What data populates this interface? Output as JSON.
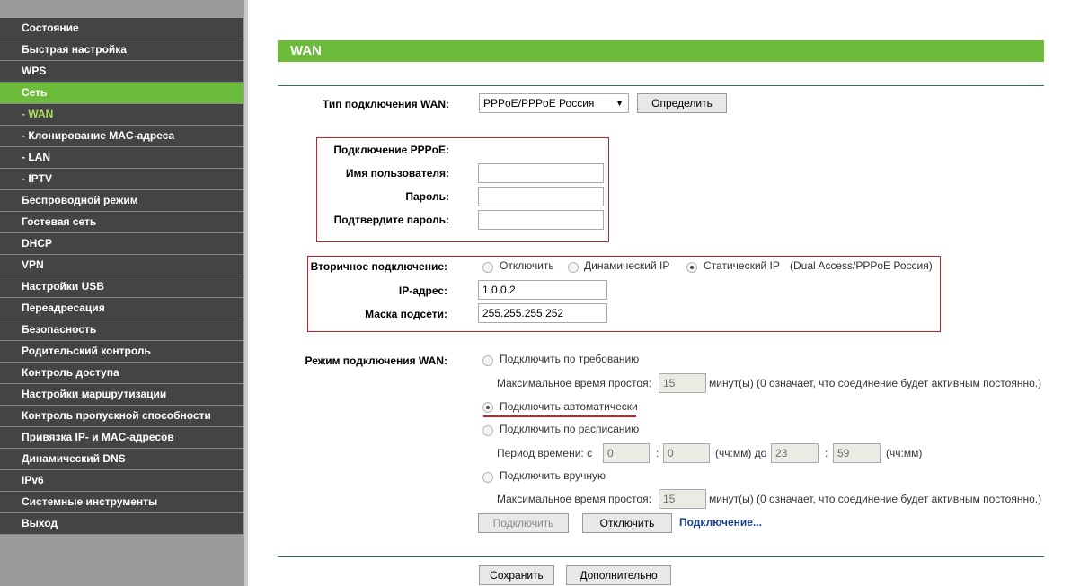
{
  "sidebar": {
    "items": [
      {
        "label": "Состояние",
        "state": ""
      },
      {
        "label": "Быстрая настройка",
        "state": ""
      },
      {
        "label": "WPS",
        "state": ""
      },
      {
        "label": "Сеть",
        "state": "active"
      },
      {
        "label": "- WAN",
        "state": "sub-active"
      },
      {
        "label": "- Клонирование MAC-адреса",
        "state": ""
      },
      {
        "label": "- LAN",
        "state": ""
      },
      {
        "label": "- IPTV",
        "state": ""
      },
      {
        "label": "Беспроводной режим",
        "state": ""
      },
      {
        "label": "Гостевая сеть",
        "state": ""
      },
      {
        "label": "DHCP",
        "state": ""
      },
      {
        "label": "VPN",
        "state": ""
      },
      {
        "label": "Настройки USB",
        "state": ""
      },
      {
        "label": "Переадресация",
        "state": ""
      },
      {
        "label": "Безопасность",
        "state": ""
      },
      {
        "label": "Родительский контроль",
        "state": ""
      },
      {
        "label": "Контроль доступа",
        "state": ""
      },
      {
        "label": "Настройки маршрутизации",
        "state": ""
      },
      {
        "label": "Контроль пропускной способности",
        "state": ""
      },
      {
        "label": "Привязка IP- и MAC-адресов",
        "state": ""
      },
      {
        "label": "Динамический DNS",
        "state": ""
      },
      {
        "label": "IPv6",
        "state": ""
      },
      {
        "label": "Системные инструменты",
        "state": ""
      },
      {
        "label": "Выход",
        "state": ""
      }
    ]
  },
  "page": {
    "title": "WAN",
    "wan_type_label": "Тип подключения WAN:",
    "wan_type_value": "PPPoE/PPPoE Россия",
    "detect_button": "Определить",
    "pppoe_heading": "Подключение PPPoE:",
    "username_label": "Имя пользователя:",
    "username_value": "",
    "password_label": "Пароль:",
    "password_value": "",
    "confirm_label": "Подтвердите пароль:",
    "confirm_value": "",
    "secondary_label": "Вторичное подключение:",
    "secondary_options": {
      "off": "Отключить",
      "dynamic": "Динамический IP",
      "static": "Статический IP",
      "note": "(Dual Access/PPPoE Россия)"
    },
    "ip_label": "IP-адрес:",
    "ip_value": "1.0.0.2",
    "mask_label": "Маска подсети:",
    "mask_value": "255.255.255.252",
    "mode_label": "Режим подключения WAN:",
    "on_demand": "Подключить по требованию",
    "idle_label": "Максимальное время простоя:",
    "idle_value_1": "15",
    "idle_note": "минут(ы) (0 означает, что соединение будет активным постоянно.)",
    "auto": "Подключить автоматически",
    "scheduled": "Подключить по расписанию",
    "period_label": "Период времени:  с",
    "period_from_h": "0",
    "period_from_m": "0",
    "period_mid": "(чч:мм) до",
    "period_to_h": "23",
    "period_to_m": "59",
    "period_end": "(чч:мм)",
    "colon": ":",
    "manual": "Подключить вручную",
    "idle_value_2": "15",
    "connect_button": "Подключить",
    "disconnect_button": "Отключить",
    "status_link": "Подключение...",
    "save_button": "Сохранить",
    "advanced_button": "Дополнительно"
  },
  "colors": {
    "accent": "#6dbb3a",
    "menu_bg": "#444444",
    "highlight": "#c0212a"
  }
}
